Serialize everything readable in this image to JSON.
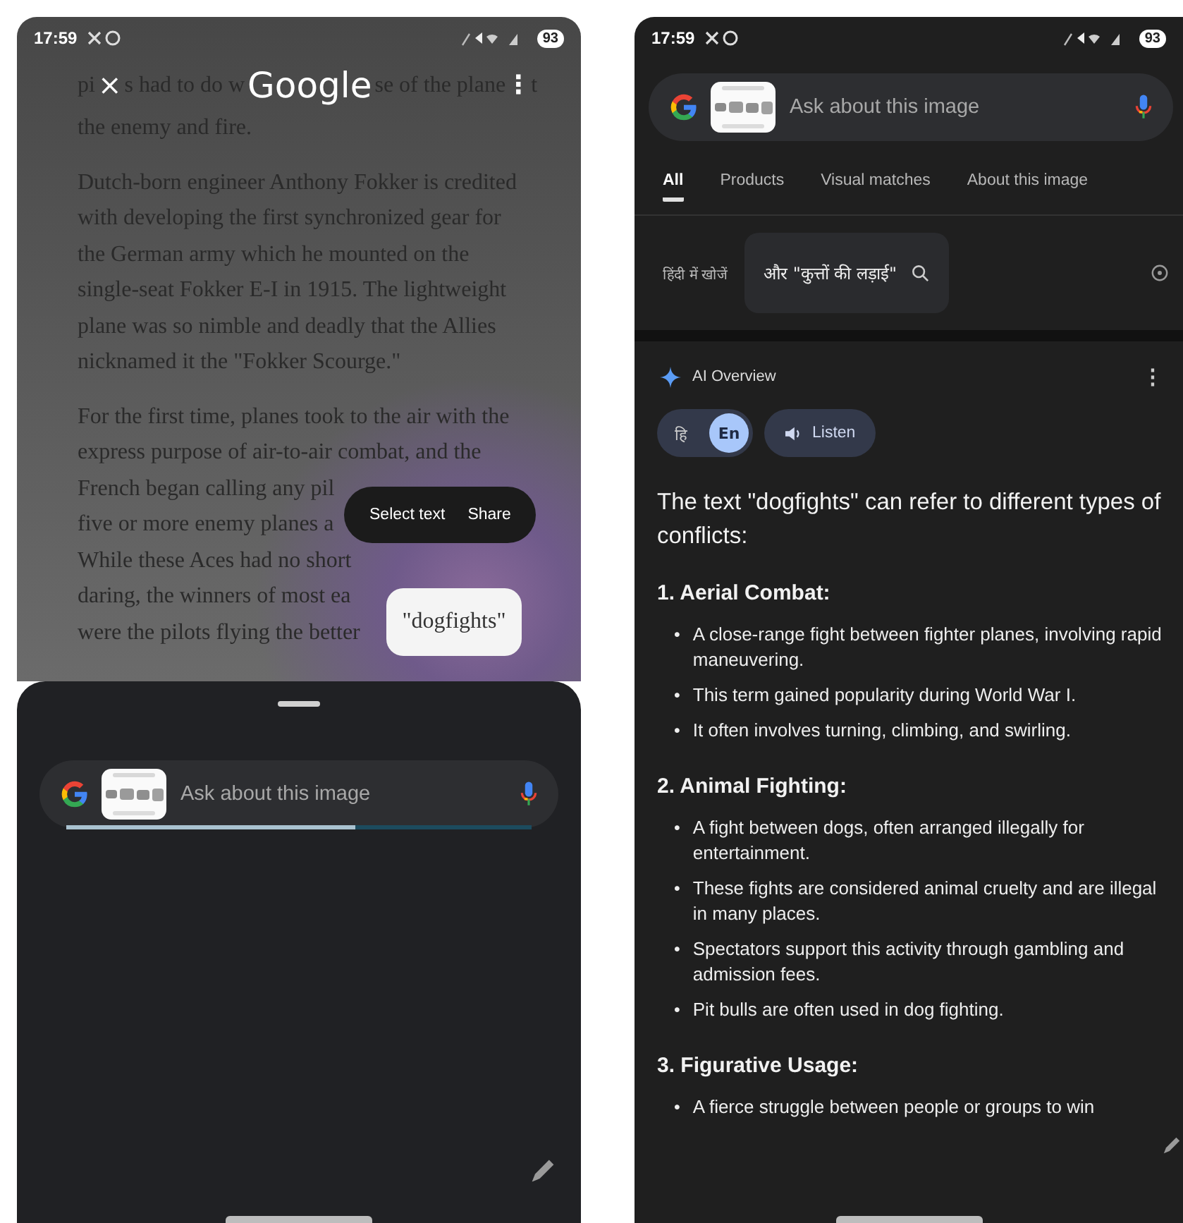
{
  "left_phone": {
    "status_bar": {
      "time": "17:59",
      "battery": "93"
    },
    "header": {
      "title": "Google",
      "close": "×",
      "menu": "⋮",
      "behind_text": [
        "pi",
        "s had to do w",
        "se of the plane",
        "t"
      ]
    },
    "article": {
      "paragraphs": [
        [
          "the enemy and fire."
        ],
        [
          "Dutch-born engineer Anthony Fokker is credited",
          "with developing the first synchronized gear for",
          "the German army which he mounted on the",
          "single-seat Fokker E-I in 1915. The lightweight",
          "plane was so nimble and deadly that the Allies",
          "nicknamed it the \"Fokker Scourge.\""
        ],
        [
          "For the first time, planes took to the air with the",
          "express purpose of air-to-air combat, and the",
          "French began calling any pil",
          "five or more enemy planes a",
          "While these Aces had no short",
          "daring, the winners of most ea",
          "were the pilots flying the better"
        ]
      ]
    },
    "selection_menu": {
      "actions": [
        "Select text",
        "Share"
      ]
    },
    "selected_word": "\"dogfights\"",
    "search_bar": {
      "placeholder": "Ask about this image",
      "level": 0.62
    }
  },
  "right_phone": {
    "status_bar": {
      "time": "17:59",
      "battery": "93"
    },
    "search_bar": {
      "placeholder": "Ask about this image"
    },
    "tabs": [
      {
        "label": "All",
        "selected": true
      },
      {
        "label": "Products",
        "selected": false
      },
      {
        "label": "Visual matches",
        "selected": false
      },
      {
        "label": "About this image",
        "selected": false
      }
    ],
    "translate_row": {
      "label": "हिंदी में खोजें",
      "suggestion": "और \"कुत्तों की लड़ाई\""
    },
    "ai_overview": {
      "title": "AI Overview",
      "menu": "⋮",
      "languages": [
        {
          "label": "हि",
          "selected": false
        },
        {
          "label": "En",
          "selected": true
        }
      ],
      "listen": "Listen",
      "intro": "The text \"dogfights\" can refer to different types of conflicts:",
      "sections": [
        {
          "heading": "1. Aerial Combat:",
          "bullets": [
            {
              "marker": "•",
              "text": "A close-range fight between fighter planes, involving rapid maneuvering."
            },
            {
              "marker": "•",
              "text": "This term gained popularity during World War I."
            },
            {
              "marker": "•",
              "text": "It often involves turning, climbing, and swirling."
            }
          ]
        },
        {
          "heading": "2. Animal Fighting:",
          "bullets": [
            {
              "marker": "•",
              "text": "A fight between dogs, often arranged illegally for entertainment."
            },
            {
              "marker": "•",
              "text": "These fights are considered animal cruelty and are illegal in many places."
            },
            {
              "marker": "•",
              "text": "Spectators support this activity through gambling and admission fees."
            },
            {
              "marker": "•",
              "text": "Pit bulls are often used in dog fighting."
            }
          ]
        },
        {
          "heading": "3. Figurative Usage:",
          "bullets": [
            {
              "marker": "•",
              "text": "A fierce struggle between people or groups to win"
            }
          ]
        }
      ]
    }
  }
}
